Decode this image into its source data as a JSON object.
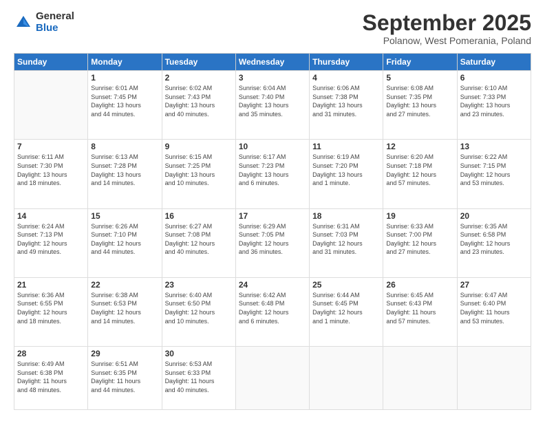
{
  "logo": {
    "general": "General",
    "blue": "Blue"
  },
  "header": {
    "month": "September 2025",
    "location": "Polanow, West Pomerania, Poland"
  },
  "days_of_week": [
    "Sunday",
    "Monday",
    "Tuesday",
    "Wednesday",
    "Thursday",
    "Friday",
    "Saturday"
  ],
  "weeks": [
    [
      {
        "day": "",
        "info": ""
      },
      {
        "day": "1",
        "info": "Sunrise: 6:01 AM\nSunset: 7:45 PM\nDaylight: 13 hours\nand 44 minutes."
      },
      {
        "day": "2",
        "info": "Sunrise: 6:02 AM\nSunset: 7:43 PM\nDaylight: 13 hours\nand 40 minutes."
      },
      {
        "day": "3",
        "info": "Sunrise: 6:04 AM\nSunset: 7:40 PM\nDaylight: 13 hours\nand 35 minutes."
      },
      {
        "day": "4",
        "info": "Sunrise: 6:06 AM\nSunset: 7:38 PM\nDaylight: 13 hours\nand 31 minutes."
      },
      {
        "day": "5",
        "info": "Sunrise: 6:08 AM\nSunset: 7:35 PM\nDaylight: 13 hours\nand 27 minutes."
      },
      {
        "day": "6",
        "info": "Sunrise: 6:10 AM\nSunset: 7:33 PM\nDaylight: 13 hours\nand 23 minutes."
      }
    ],
    [
      {
        "day": "7",
        "info": "Sunrise: 6:11 AM\nSunset: 7:30 PM\nDaylight: 13 hours\nand 18 minutes."
      },
      {
        "day": "8",
        "info": "Sunrise: 6:13 AM\nSunset: 7:28 PM\nDaylight: 13 hours\nand 14 minutes."
      },
      {
        "day": "9",
        "info": "Sunrise: 6:15 AM\nSunset: 7:25 PM\nDaylight: 13 hours\nand 10 minutes."
      },
      {
        "day": "10",
        "info": "Sunrise: 6:17 AM\nSunset: 7:23 PM\nDaylight: 13 hours\nand 6 minutes."
      },
      {
        "day": "11",
        "info": "Sunrise: 6:19 AM\nSunset: 7:20 PM\nDaylight: 13 hours\nand 1 minute."
      },
      {
        "day": "12",
        "info": "Sunrise: 6:20 AM\nSunset: 7:18 PM\nDaylight: 12 hours\nand 57 minutes."
      },
      {
        "day": "13",
        "info": "Sunrise: 6:22 AM\nSunset: 7:15 PM\nDaylight: 12 hours\nand 53 minutes."
      }
    ],
    [
      {
        "day": "14",
        "info": "Sunrise: 6:24 AM\nSunset: 7:13 PM\nDaylight: 12 hours\nand 49 minutes."
      },
      {
        "day": "15",
        "info": "Sunrise: 6:26 AM\nSunset: 7:10 PM\nDaylight: 12 hours\nand 44 minutes."
      },
      {
        "day": "16",
        "info": "Sunrise: 6:27 AM\nSunset: 7:08 PM\nDaylight: 12 hours\nand 40 minutes."
      },
      {
        "day": "17",
        "info": "Sunrise: 6:29 AM\nSunset: 7:05 PM\nDaylight: 12 hours\nand 36 minutes."
      },
      {
        "day": "18",
        "info": "Sunrise: 6:31 AM\nSunset: 7:03 PM\nDaylight: 12 hours\nand 31 minutes."
      },
      {
        "day": "19",
        "info": "Sunrise: 6:33 AM\nSunset: 7:00 PM\nDaylight: 12 hours\nand 27 minutes."
      },
      {
        "day": "20",
        "info": "Sunrise: 6:35 AM\nSunset: 6:58 PM\nDaylight: 12 hours\nand 23 minutes."
      }
    ],
    [
      {
        "day": "21",
        "info": "Sunrise: 6:36 AM\nSunset: 6:55 PM\nDaylight: 12 hours\nand 18 minutes."
      },
      {
        "day": "22",
        "info": "Sunrise: 6:38 AM\nSunset: 6:53 PM\nDaylight: 12 hours\nand 14 minutes."
      },
      {
        "day": "23",
        "info": "Sunrise: 6:40 AM\nSunset: 6:50 PM\nDaylight: 12 hours\nand 10 minutes."
      },
      {
        "day": "24",
        "info": "Sunrise: 6:42 AM\nSunset: 6:48 PM\nDaylight: 12 hours\nand 6 minutes."
      },
      {
        "day": "25",
        "info": "Sunrise: 6:44 AM\nSunset: 6:45 PM\nDaylight: 12 hours\nand 1 minute."
      },
      {
        "day": "26",
        "info": "Sunrise: 6:45 AM\nSunset: 6:43 PM\nDaylight: 11 hours\nand 57 minutes."
      },
      {
        "day": "27",
        "info": "Sunrise: 6:47 AM\nSunset: 6:40 PM\nDaylight: 11 hours\nand 53 minutes."
      }
    ],
    [
      {
        "day": "28",
        "info": "Sunrise: 6:49 AM\nSunset: 6:38 PM\nDaylight: 11 hours\nand 48 minutes."
      },
      {
        "day": "29",
        "info": "Sunrise: 6:51 AM\nSunset: 6:35 PM\nDaylight: 11 hours\nand 44 minutes."
      },
      {
        "day": "30",
        "info": "Sunrise: 6:53 AM\nSunset: 6:33 PM\nDaylight: 11 hours\nand 40 minutes."
      },
      {
        "day": "",
        "info": ""
      },
      {
        "day": "",
        "info": ""
      },
      {
        "day": "",
        "info": ""
      },
      {
        "day": "",
        "info": ""
      }
    ]
  ]
}
